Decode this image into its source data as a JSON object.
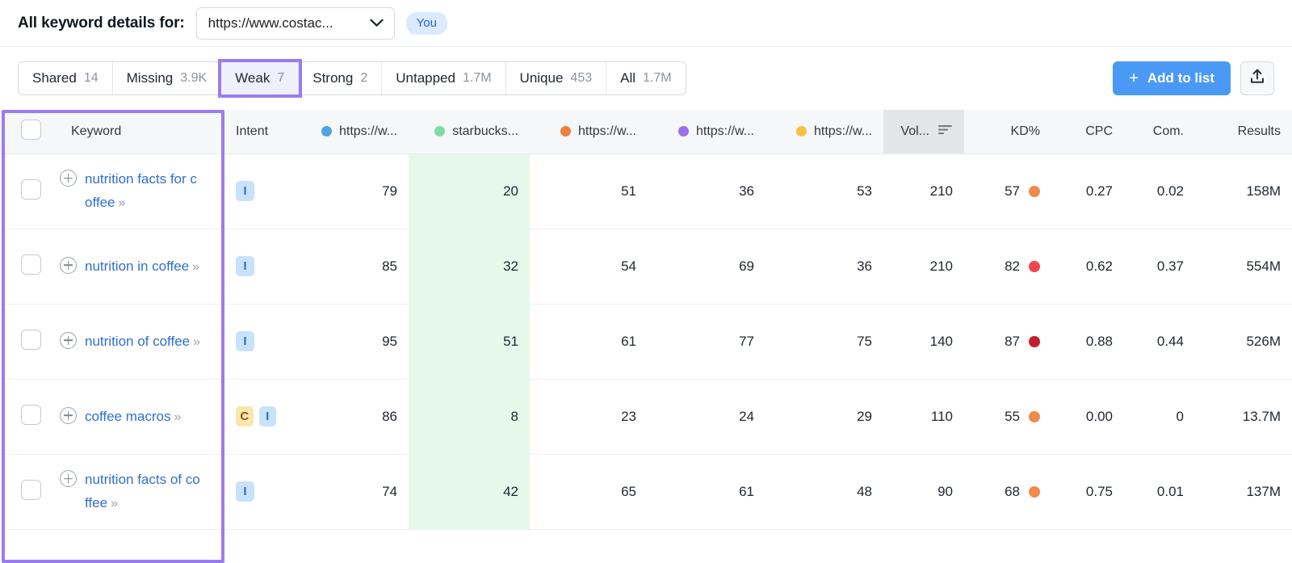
{
  "header": {
    "title": "All keyword details for:",
    "domain_selector": {
      "value": "https://www.costac...",
      "icon": "chevron-down-icon"
    },
    "you_badge": "You"
  },
  "filter_bar": {
    "tabs": [
      {
        "label": "Shared",
        "count": "14",
        "active": false
      },
      {
        "label": "Missing",
        "count": "3.9K",
        "active": false
      },
      {
        "label": "Weak",
        "count": "7",
        "active": true
      },
      {
        "label": "Strong",
        "count": "2",
        "active": false
      },
      {
        "label": "Untapped",
        "count": "1.7M",
        "active": false
      },
      {
        "label": "Unique",
        "count": "453",
        "active": false
      },
      {
        "label": "All",
        "count": "1.7M",
        "active": false
      }
    ],
    "add_to_list": {
      "label": "Add to list",
      "icon": "plus-icon"
    },
    "export": {
      "icon": "export-upload-icon"
    }
  },
  "table": {
    "columns": {
      "checkbox": "select-all-checkbox",
      "keyword": "Keyword",
      "intent": "Intent",
      "site1": {
        "label": "https://w...",
        "color": "#4fa3e3"
      },
      "site2": {
        "label": "starbucks...",
        "color": "#7ddba5"
      },
      "site3": {
        "label": "https://w...",
        "color": "#f07f3c"
      },
      "site4": {
        "label": "https://w...",
        "color": "#9b6fe8"
      },
      "site5": {
        "label": "https://w...",
        "color": "#f5c242"
      },
      "volume": {
        "label": "Vol...",
        "sorted": true,
        "sort_icon": "sort-descending-icon"
      },
      "kd": "KD%",
      "cpc": "CPC",
      "com": "Com.",
      "results": "Results"
    },
    "rows": [
      {
        "keyword": "nutrition facts for coffee",
        "intents": [
          "I"
        ],
        "site1": "79",
        "site2": "20",
        "site3": "51",
        "site4": "36",
        "site5": "53",
        "volume": "210",
        "kd": "57",
        "kd_color": "#ef8b4a",
        "cpc": "0.27",
        "com": "0.02",
        "results": "158M"
      },
      {
        "keyword": "nutrition in coffee",
        "intents": [
          "I"
        ],
        "site1": "85",
        "site2": "32",
        "site3": "54",
        "site4": "69",
        "site5": "36",
        "volume": "210",
        "kd": "82",
        "kd_color": "#f4454f",
        "cpc": "0.62",
        "com": "0.37",
        "results": "554M"
      },
      {
        "keyword": "nutrition of coffee",
        "intents": [
          "I"
        ],
        "site1": "95",
        "site2": "51",
        "site3": "61",
        "site4": "77",
        "site5": "75",
        "volume": "140",
        "kd": "87",
        "kd_color": "#c41f2e",
        "cpc": "0.88",
        "com": "0.44",
        "results": "526M"
      },
      {
        "keyword": "coffee macros",
        "intents": [
          "C",
          "I"
        ],
        "site1": "86",
        "site2": "8",
        "site3": "23",
        "site4": "24",
        "site5": "29",
        "volume": "110",
        "kd": "55",
        "kd_color": "#ef8b4a",
        "cpc": "0.00",
        "com": "0",
        "results": "13.7M"
      },
      {
        "keyword": "nutrition facts of coffee",
        "intents": [
          "I"
        ],
        "site1": "74",
        "site2": "42",
        "site3": "65",
        "site4": "61",
        "site5": "48",
        "volume": "90",
        "kd": "68",
        "kd_color": "#ef8b4a",
        "cpc": "0.75",
        "com": "0.01",
        "results": "137M"
      }
    ]
  },
  "annotations": {
    "color": "#9a7cf2",
    "highlight_tab": "Weak",
    "highlight_column": "Keyword"
  }
}
